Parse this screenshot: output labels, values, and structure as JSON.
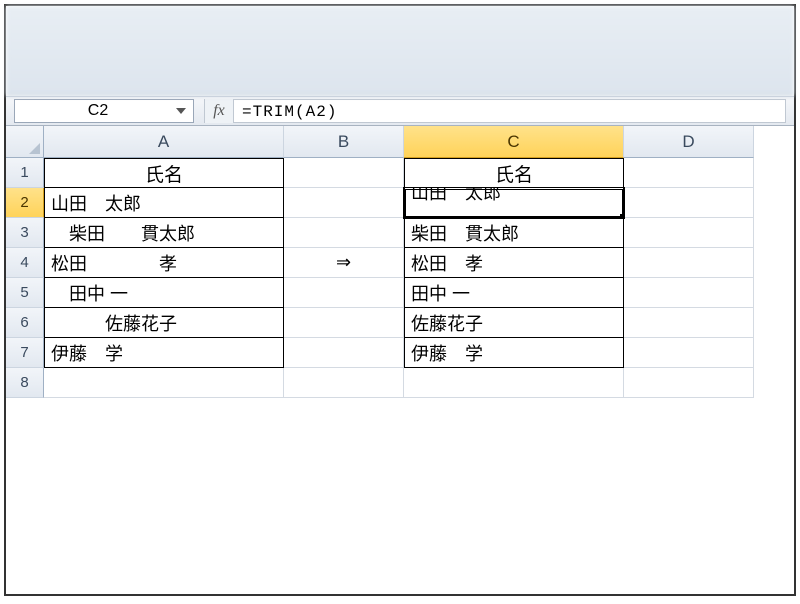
{
  "formula_bar": {
    "name_box": "C2",
    "fx_label": "fx",
    "formula": "=TRIM(A2)"
  },
  "columns": [
    "A",
    "B",
    "C",
    "D"
  ],
  "row_numbers": [
    "1",
    "2",
    "3",
    "4",
    "5",
    "6",
    "7",
    "8"
  ],
  "active": {
    "cell": "C2",
    "row": "2",
    "col": "C"
  },
  "arrow": "⇒",
  "headers": {
    "A1": "氏名",
    "C1": "氏名"
  },
  "colA": [
    "山田　太郎",
    "　柴田　　貫太郎",
    "松田　　　　孝",
    "　田中 一",
    "　　　佐藤花子",
    "伊藤　学　"
  ],
  "colC": [
    "山田　太郎",
    "柴田　貫太郎",
    "松田　孝",
    "田中 一",
    "佐藤花子",
    "伊藤　学"
  ]
}
